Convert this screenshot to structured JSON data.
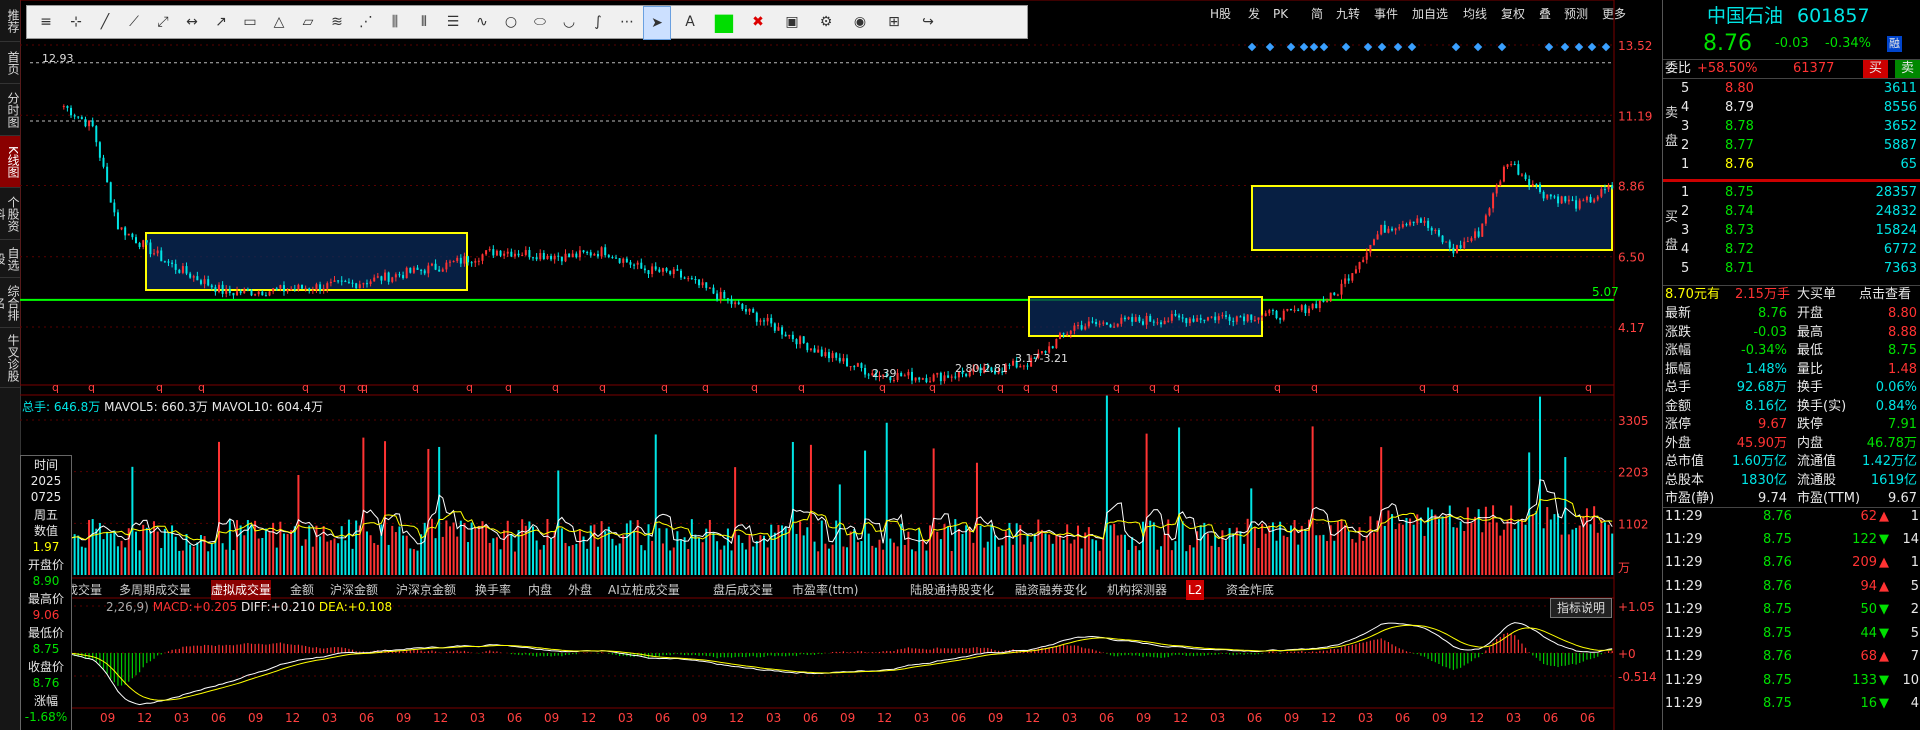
{
  "left_nav": [
    {
      "label": "推荐"
    },
    {
      "label": "首页"
    },
    {
      "label": "分时图"
    },
    {
      "label": "K线图"
    },
    {
      "label": "个股资料"
    },
    {
      "label": "自选股"
    },
    {
      "label": "综合排名"
    },
    {
      "label": "牛叉诊股"
    }
  ],
  "toolbar": {
    "icons": [
      "ruler-icon",
      "crosshair-icon",
      "line-icon",
      "ray-icon",
      "segment-icon",
      "hline-icon",
      "arrow-icon",
      "rect-icon",
      "triangle-icon",
      "parallelogram-icon",
      "fan-icon",
      "gann-icon",
      "bars-icon",
      "parallel-icon",
      "text-icon",
      "wave-icon",
      "circle-icon",
      "ellipse-icon",
      "arc-icon",
      "curve-icon",
      "dots-icon",
      "cursor-icon",
      "text-tool-icon",
      "color-swatch",
      "delete-icon",
      "save-icon",
      "settings-icon",
      "eye-icon",
      "grid-icon",
      "share-icon"
    ]
  },
  "top_menu": [
    "H股",
    "发",
    "PK",
    "简",
    "九转",
    "事件",
    "加自选",
    "均线",
    "复权",
    "叠",
    "预测",
    "更多"
  ],
  "chart": {
    "price_axis": [
      "13.52",
      "11.19",
      "8.86",
      "6.50",
      "4.17"
    ],
    "high_label": "12.93",
    "support_label": "5.07",
    "low_labels": [
      "2.39",
      "2.80-2.81",
      "3.17-3.21"
    ],
    "volume_axis": [
      "3305",
      "2203",
      "1102"
    ],
    "volume_unit": "万",
    "macd_axis": [
      "+1.05",
      "+0",
      "-0.514"
    ],
    "x_ticks": [
      "09",
      "12",
      "03",
      "06",
      "09",
      "12",
      "03",
      "06",
      "09",
      "12",
      "03",
      "06",
      "09",
      "12",
      "03",
      "06",
      "09",
      "12",
      "03",
      "06",
      "09",
      "12",
      "03",
      "06",
      "09",
      "12",
      "03",
      "06",
      "09",
      "12",
      "03",
      "06",
      "09",
      "12",
      "03",
      "06",
      "09",
      "12",
      "03",
      "06",
      "06"
    ]
  },
  "volume_legend": {
    "total_label": "总手:",
    "total_value": "646.8万",
    "ma5_label": "MAVOL5:",
    "ma5_value": "660.3万",
    "ma10_label": "MAVOL10:",
    "ma10_value": "604.4万"
  },
  "macd_legend": {
    "params": "2,26,9)",
    "macd_label": "MACD:",
    "macd_value": "+0.205",
    "diff_label": "DIFF:",
    "diff_value": "+0.210",
    "dea_label": "DEA:",
    "dea_value": "+0.108",
    "indicator_button": "指标说明"
  },
  "tabs": [
    "成交量",
    "多周期成交量",
    "虚拟成交量",
    "金额",
    "沪深金额",
    "沪深京金额",
    "换手率",
    "内盘",
    "外盘",
    "AI立桩成交量",
    "盘后成交量",
    "市盈率(ttm)",
    "陆股通持股变化",
    "融资融券变化",
    "机构探测器",
    "L2",
    "资金炸底"
  ],
  "info_box": {
    "time_label": "时间",
    "year": "2025",
    "date": "0725",
    "weekday": "周五",
    "value_label": "数值",
    "value": "1.97",
    "open_label": "开盘价",
    "open": "8.90",
    "high_label": "最高价",
    "high": "9.06",
    "low_label": "最低价",
    "low": "8.75",
    "close_label": "收盘价",
    "close": "8.76",
    "change_label": "涨幅",
    "change": "-1.68%"
  },
  "quote": {
    "name": "中国石油",
    "code": "601857",
    "price": "8.76",
    "change": "-0.03",
    "change_pct": "-0.34%",
    "tag": "融",
    "weibi_label": "委比",
    "weibi": "+58.50%",
    "weicha": "61377",
    "buy_btn": "买",
    "sell_btn": "卖",
    "sell_side_label": "卖盘",
    "buy_side_label": "买盘",
    "asks": [
      {
        "lvl": "5",
        "price": "8.80",
        "vol": "3611"
      },
      {
        "lvl": "4",
        "price": "8.79",
        "vol": "8556"
      },
      {
        "lvl": "3",
        "price": "8.78",
        "vol": "3652"
      },
      {
        "lvl": "2",
        "price": "8.77",
        "vol": "5887"
      },
      {
        "lvl": "1",
        "price": "8.76",
        "vol": "65"
      }
    ],
    "bids": [
      {
        "lvl": "1",
        "price": "8.75",
        "vol": "28357"
      },
      {
        "lvl": "2",
        "price": "8.74",
        "vol": "24832"
      },
      {
        "lvl": "3",
        "price": "8.73",
        "vol": "15824"
      },
      {
        "lvl": "4",
        "price": "8.72",
        "vol": "6772"
      },
      {
        "lvl": "5",
        "price": "8.71",
        "vol": "7363"
      }
    ],
    "bigorder": {
      "p": "8.70元有",
      "v": "2.15万手",
      "t": "大买单",
      "link": "点击查看"
    },
    "stats": [
      {
        "l1": "最新",
        "v1": "8.76",
        "l2": "开盘",
        "v2": "8.80"
      },
      {
        "l1": "涨跌",
        "v1": "-0.03",
        "l2": "最高",
        "v2": "8.88"
      },
      {
        "l1": "涨幅",
        "v1": "-0.34%",
        "l2": "最低",
        "v2": "8.75"
      },
      {
        "l1": "振幅",
        "v1": "1.48%",
        "l2": "量比",
        "v2": "1.48"
      },
      {
        "l1": "总手",
        "v1": "92.68万",
        "l2": "换手",
        "v2": "0.06%"
      },
      {
        "l1": "金额",
        "v1": "8.16亿",
        "l2": "换手(实)",
        "v2": "0.84%"
      },
      {
        "l1": "涨停",
        "v1": "9.67",
        "l2": "跌停",
        "v2": "7.91"
      },
      {
        "l1": "外盘",
        "v1": "45.90万",
        "l2": "内盘",
        "v2": "46.78万"
      },
      {
        "l1": "总市值",
        "v1": "1.60万亿",
        "l2": "流通值",
        "v2": "1.42万亿"
      },
      {
        "l1": "总股本",
        "v1": "1830亿",
        "l2": "流通股",
        "v2": "1619亿"
      },
      {
        "l1": "市盈(静)",
        "v1": "9.74",
        "l2": "市盈(TTM)",
        "v2": "9.67"
      }
    ],
    "ticks": [
      {
        "t": "11:29",
        "p": "8.76",
        "v": "62",
        "d": "1"
      },
      {
        "t": "11:29",
        "p": "8.75",
        "v": "122",
        "d": "14"
      },
      {
        "t": "11:29",
        "p": "8.76",
        "v": "209",
        "d": "1"
      },
      {
        "t": "11:29",
        "p": "8.76",
        "v": "94",
        "d": "5"
      },
      {
        "t": "11:29",
        "p": "8.75",
        "v": "50",
        "d": "2"
      },
      {
        "t": "11:29",
        "p": "8.75",
        "v": "44",
        "d": "5"
      },
      {
        "t": "11:29",
        "p": "8.76",
        "v": "68",
        "d": "7"
      },
      {
        "t": "11:29",
        "p": "8.75",
        "v": "133",
        "d": "10"
      },
      {
        "t": "11:29",
        "p": "8.75",
        "v": "16",
        "d": "4"
      }
    ]
  },
  "colors": {
    "up": "#ff3333",
    "down": "#00e5e5",
    "support": "#00ff00",
    "box": "#ffff00",
    "box_fill": "#0a2a5a"
  }
}
